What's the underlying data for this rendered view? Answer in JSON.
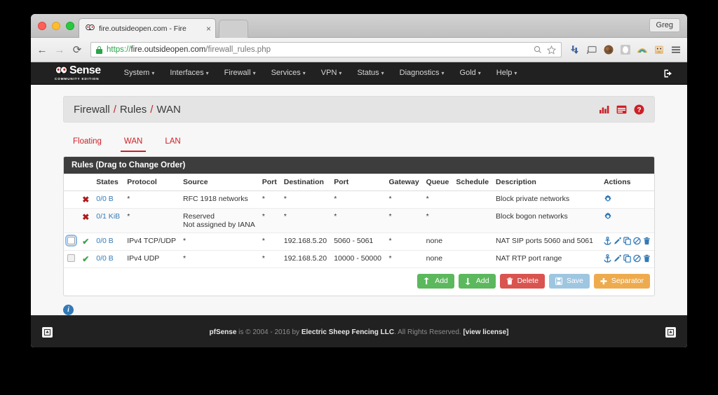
{
  "browser": {
    "tab": {
      "title": "fire.outsideopen.com - Fire",
      "close": "×",
      "favicon": "pfsense-favicon"
    },
    "nav": {
      "back": "←",
      "forward": "→",
      "reload": "⟳"
    },
    "omnibox": {
      "scheme": "https://",
      "host": "fire.outsideopen.com",
      "path": "/firewall_rules.php",
      "lock": "lock-icon",
      "search_icon": "search-icon",
      "bookmark_icon": "star-icon"
    },
    "extensions": [
      "download-icon",
      "cast-icon",
      "brown-avatar-icon",
      "white-oval-icon",
      "rainbow-arc-icon",
      "robot-icon"
    ],
    "menu_icon": "hamburger-menu-icon",
    "profile": "Greg"
  },
  "navbar": {
    "logo_main": "Sense",
    "logo_sub": "COMMUNITY EDITION",
    "items": [
      {
        "label": "System",
        "caret": "▾"
      },
      {
        "label": "Interfaces",
        "caret": "▾"
      },
      {
        "label": "Firewall",
        "caret": "▾"
      },
      {
        "label": "Services",
        "caret": "▾"
      },
      {
        "label": "VPN",
        "caret": "▾"
      },
      {
        "label": "Status",
        "caret": "▾"
      },
      {
        "label": "Diagnostics",
        "caret": "▾"
      },
      {
        "label": "Gold",
        "caret": "▾"
      },
      {
        "label": "Help",
        "caret": "▾"
      }
    ],
    "logout": "logout-icon"
  },
  "breadcrumb": {
    "parts": [
      "Firewall",
      "Rules",
      "WAN"
    ],
    "separator": "/",
    "icons": [
      "bar-chart-icon",
      "table-icon",
      "help-icon"
    ],
    "accent": "#cc2027"
  },
  "tabs": [
    {
      "label": "Floating",
      "active": false
    },
    {
      "label": "WAN",
      "active": true
    },
    {
      "label": "LAN",
      "active": false
    }
  ],
  "panel": {
    "title": "Rules (Drag to Change Order)",
    "columns": [
      "",
      "",
      "States",
      "Protocol",
      "Source",
      "Port",
      "Destination",
      "Port",
      "Gateway",
      "Queue",
      "Schedule",
      "Description",
      "Actions"
    ],
    "rows": [
      {
        "checkbox": "none",
        "status": "block",
        "states": "0/0 B",
        "protocol": "*",
        "source": "RFC 1918 networks",
        "source_line2": "",
        "port": "*",
        "destination": "*",
        "dest_port": "*",
        "gateway": "*",
        "queue": "*",
        "schedule": "",
        "description": "Block private networks",
        "actions": [
          "gear-icon"
        ]
      },
      {
        "checkbox": "none",
        "status": "block",
        "states": "0/1 KiB",
        "protocol": "*",
        "source": "Reserved",
        "source_line2": "Not assigned by IANA",
        "port": "*",
        "destination": "*",
        "dest_port": "*",
        "gateway": "*",
        "queue": "*",
        "schedule": "",
        "description": "Block bogon networks",
        "actions": [
          "gear-icon"
        ]
      },
      {
        "checkbox": "focused",
        "status": "pass",
        "states": "0/0 B",
        "protocol": "IPv4 TCP/UDP",
        "source": "*",
        "source_line2": "",
        "port": "*",
        "destination": "192.168.5.20",
        "dest_port": "5060 - 5061",
        "gateway": "*",
        "queue": "none",
        "schedule": "",
        "description": "NAT SIP ports 5060 and 5061",
        "actions": [
          "anchor-icon",
          "edit-pencil-icon",
          "copy-icon",
          "disable-icon",
          "delete-trash-icon"
        ]
      },
      {
        "checkbox": "normal",
        "status": "pass",
        "states": "0/0 B",
        "protocol": "IPv4 UDP",
        "source": "*",
        "source_line2": "",
        "port": "*",
        "destination": "192.168.5.20",
        "dest_port": "10000 - 50000",
        "gateway": "*",
        "queue": "none",
        "schedule": "",
        "description": "NAT RTP port range",
        "actions": [
          "anchor-icon",
          "edit-pencil-icon",
          "copy-icon",
          "disable-icon",
          "delete-trash-icon"
        ]
      }
    ]
  },
  "buttons": [
    {
      "label": "Add",
      "icon": "arrow-up-icon",
      "color": "#5cb85c",
      "name": "add-up-button"
    },
    {
      "label": "Add",
      "icon": "arrow-down-icon",
      "color": "#5cb85c",
      "name": "add-down-button"
    },
    {
      "label": "Delete",
      "icon": "trash-icon",
      "color": "#d9534f",
      "name": "delete-button"
    },
    {
      "label": "Save",
      "icon": "floppy-save-icon",
      "color": "#9fc6e0",
      "name": "save-button"
    },
    {
      "label": "Separator",
      "icon": "plus-icon",
      "color": "#eeab4e",
      "name": "separator-button"
    }
  ],
  "info": {
    "icon": "info-icon",
    "glyph": "i"
  },
  "footer": {
    "left_icon": "panel-toggle-icon",
    "right_icon": "panel-toggle-icon",
    "brand": "pfSense",
    "text_1": " is © 2004 - 2016 by ",
    "company": "Electric Sheep Fencing LLC",
    "text_2": ". All Rights Reserved. ",
    "license": "[view license]"
  }
}
